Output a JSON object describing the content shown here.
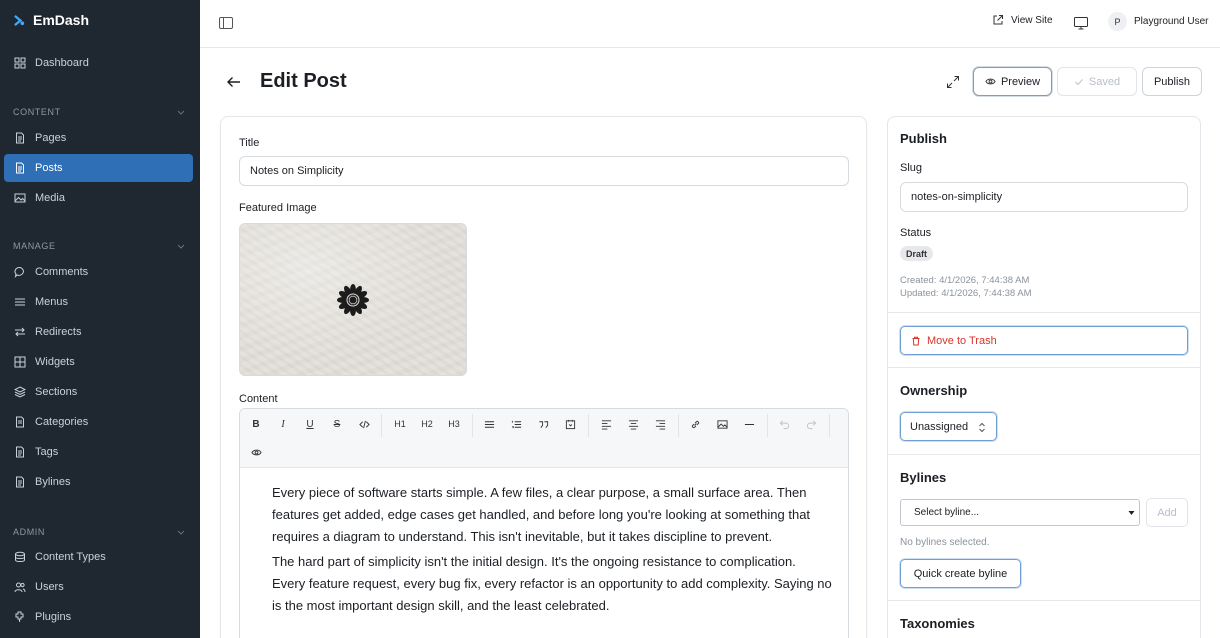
{
  "app": {
    "name": "EmDash"
  },
  "sidebar": {
    "dashboard": "Dashboard",
    "sections": [
      {
        "label": "CONTENT",
        "items": [
          "Pages",
          "Posts",
          "Media"
        ]
      },
      {
        "label": "MANAGE",
        "items": [
          "Comments",
          "Menus",
          "Redirects",
          "Widgets",
          "Sections",
          "Categories",
          "Tags",
          "Bylines"
        ]
      },
      {
        "label": "ADMIN",
        "items": [
          "Content Types",
          "Users",
          "Plugins"
        ]
      }
    ],
    "active": "Posts"
  },
  "topbar": {
    "view_site": "View Site",
    "user_initial": "P",
    "user_name": "Playground User"
  },
  "header": {
    "title": "Edit Post",
    "preview": "Preview",
    "saved": "Saved",
    "publish": "Publish"
  },
  "editor": {
    "title_label": "Title",
    "title_value": "Notes on Simplicity",
    "featured_label": "Featured Image",
    "content_label": "Content",
    "toolbar": {
      "bold": "B",
      "italic": "I",
      "underline": "U",
      "strike": "S",
      "h1": "H1",
      "h2": "H2",
      "h3": "H3"
    },
    "paragraphs": [
      "Every piece of software starts simple. A few files, a clear purpose, a small surface area. Then features get added, edge cases get handled, and before long you're looking at something that requires a diagram to understand. This isn't inevitable, but it takes discipline to prevent.",
      "The hard part of simplicity isn't the initial design. It's the ongoing resistance to complication. Every feature request, every bug fix, every refactor is an opportunity to add complexity. Saying no is the most important design skill, and the least celebrated."
    ]
  },
  "publish_panel": {
    "heading": "Publish",
    "slug_label": "Slug",
    "slug_value": "notes-on-simplicity",
    "status_label": "Status",
    "status_value": "Draft",
    "created": "Created: 4/1/2026, 7:44:38 AM",
    "updated": "Updated: 4/1/2026, 7:44:38 AM",
    "trash": "Move to Trash"
  },
  "ownership": {
    "heading": "Ownership",
    "value": "Unassigned"
  },
  "bylines": {
    "heading": "Bylines",
    "select_placeholder": "Select byline...",
    "add": "Add",
    "empty": "No bylines selected.",
    "quick_create": "Quick create byline"
  },
  "taxonomies": {
    "heading": "Taxonomies"
  },
  "colors": {
    "sidebar_bg": "#1f2730",
    "active": "#2f6fb6",
    "danger": "#d9352b",
    "focus": "#6f9fd6"
  }
}
